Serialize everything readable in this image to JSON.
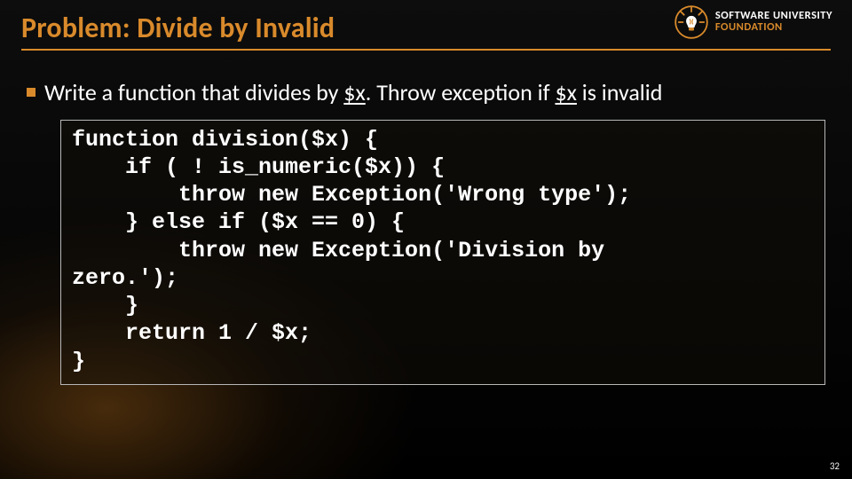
{
  "header": {
    "title": "Problem: Divide by Invalid"
  },
  "logo": {
    "line1": "SOFTWARE UNIVERSITY",
    "line2": "FOUNDATION"
  },
  "bullet": {
    "pre": "Write a function that divides by ",
    "var1": "$x",
    "mid": ". Throw exception if ",
    "var2": "$x",
    "post": " is invalid"
  },
  "code": {
    "l1": "function division($x) {",
    "l2": "    if ( ! is_numeric($x)) {",
    "l3": "        throw new Exception('Wrong type');",
    "l4": "    } else if ($x == 0) {",
    "l5": "        throw new Exception('Division by ",
    "l6": "zero.');",
    "l7": "    }",
    "l8": "    return 1 / $x;",
    "l9": "}"
  },
  "pageNumber": "32"
}
